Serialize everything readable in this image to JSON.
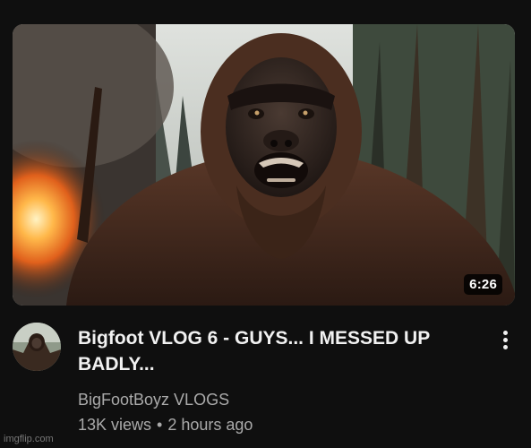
{
  "video": {
    "title": "Bigfoot VLOG 6 - GUYS... I MESSED UP BADLY...",
    "duration": "6:26",
    "channel": "BigFootBoyz VLOGS",
    "views": "13K views",
    "separator": "•",
    "age": "2 hours ago"
  },
  "thumbnail": {
    "subject": "bigfoot-face",
    "colors": {
      "fire": "#f28a2e",
      "fur": "#4a2f22",
      "forest": "#3f4a3e",
      "sky": "#d9dcd8"
    }
  },
  "icons": {
    "more": "kebab-menu-icon",
    "avatar": "channel-avatar"
  },
  "watermark": "imgflip.com",
  "colors": {
    "background": "#0f0f0f",
    "title": "#f1f1f1",
    "secondary": "#aaaaaa",
    "duration_bg": "#000000"
  }
}
